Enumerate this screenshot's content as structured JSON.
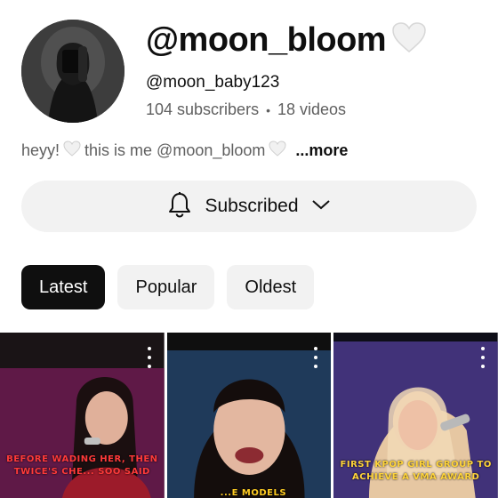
{
  "channel": {
    "name": "@moon_bloom",
    "name_emoji": "white-heart-icon",
    "handle": "@moon_baby123",
    "subscribers": "104 subscribers",
    "separator": "•",
    "videos": "18 videos",
    "description": "heyy!",
    "description_mid": " this is me @moon_bloom",
    "more_label": "...more"
  },
  "subscribe_button": {
    "label": "Subscribed",
    "icon": "bell-icon",
    "chevron": "chevron-down-icon"
  },
  "filters": [
    {
      "label": "Latest",
      "active": true
    },
    {
      "label": "Popular",
      "active": false
    },
    {
      "label": "Oldest",
      "active": false
    }
  ],
  "shorts": [
    {
      "caption": "BEFORE WADING HER, THEN TWICE'S CHE... SOO SAID",
      "caption_color": "#ff3a3a"
    },
    {
      "caption": "...E MODELS",
      "caption_color": "#ffcc22"
    },
    {
      "caption": "FIRST KPOP GIRL GROUP TO ACHIEVE A VMA AWARD",
      "caption_color": "#ffd43a"
    }
  ]
}
